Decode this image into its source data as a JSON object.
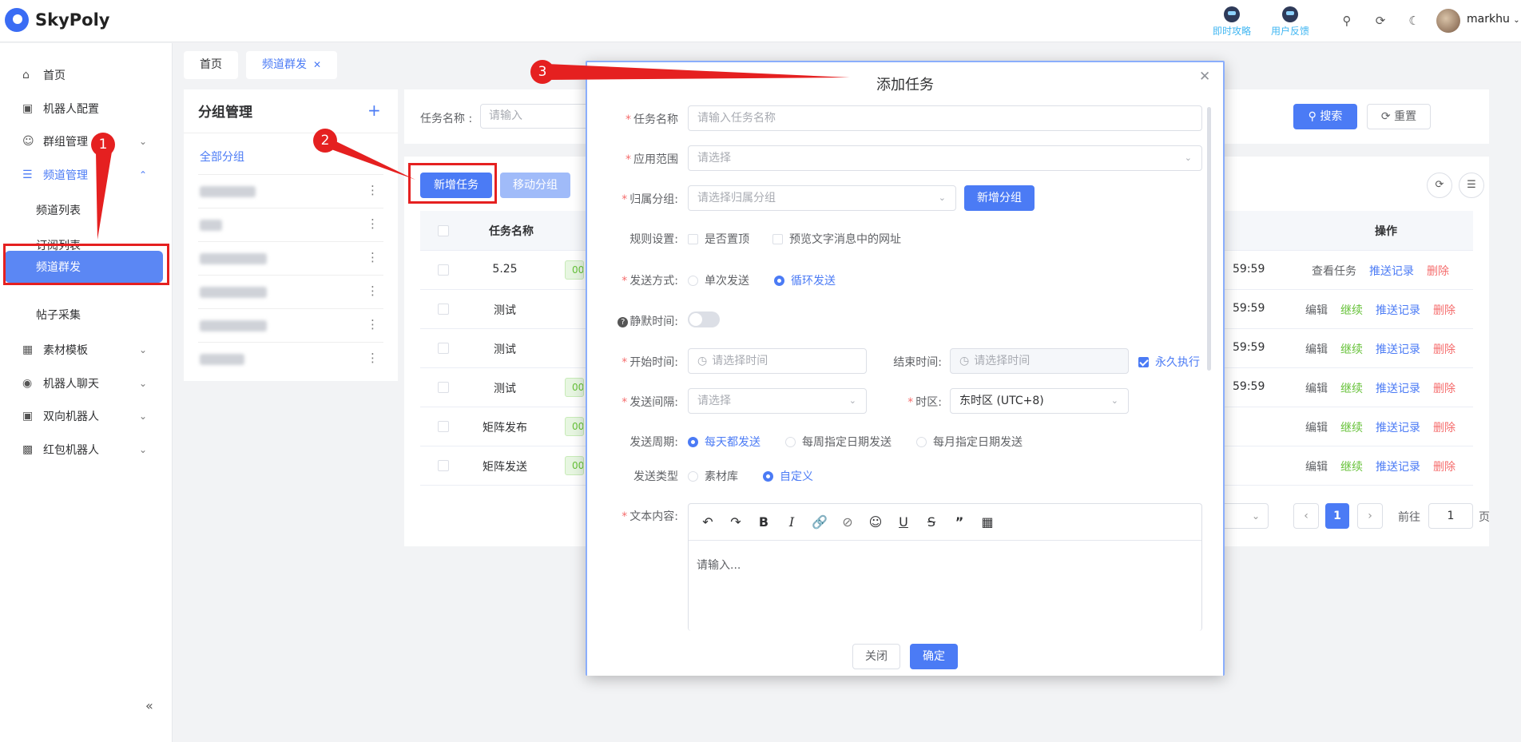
{
  "app": {
    "title": "SkyPoly"
  },
  "header": {
    "quick_start": "即时攻略",
    "feedback": "用户反馈",
    "username": "markhu"
  },
  "sidebar": {
    "items": [
      {
        "label": "首页"
      },
      {
        "label": "机器人配置"
      },
      {
        "label": "群组管理"
      },
      {
        "label": "频道管理"
      },
      {
        "label": "频道列表"
      },
      {
        "label": "订阅列表"
      },
      {
        "label": "频道群发"
      },
      {
        "label": "帖子采集"
      },
      {
        "label": "素材模板"
      },
      {
        "label": "机器人聊天"
      },
      {
        "label": "双向机器人"
      },
      {
        "label": "红包机器人"
      }
    ]
  },
  "tabs": [
    {
      "label": "首页"
    },
    {
      "label": "频道群发"
    }
  ],
  "group_panel": {
    "title": "分组管理",
    "all": "全部分组"
  },
  "search": {
    "label": "任务名称 :",
    "placeholder": "请输入",
    "search_btn": "搜索",
    "reset_btn": "重置"
  },
  "toolbar": {
    "new_task": "新增任务",
    "move_group": "移动分组"
  },
  "table": {
    "headers": {
      "name": "任务名称",
      "ops": "操作"
    },
    "rows": [
      {
        "name": "5.25",
        "tag": "00",
        "time": "59:59",
        "ops": [
          "查看任务",
          "推送记录",
          "删除"
        ]
      },
      {
        "name": "测试",
        "tag": "",
        "time": "59:59",
        "ops": [
          "编辑",
          "继续",
          "推送记录",
          "删除"
        ]
      },
      {
        "name": "测试",
        "tag": "",
        "time": "59:59",
        "ops": [
          "编辑",
          "继续",
          "推送记录",
          "删除"
        ]
      },
      {
        "name": "测试",
        "tag": "00",
        "time": "59:59",
        "ops": [
          "编辑",
          "继续",
          "推送记录",
          "删除"
        ]
      },
      {
        "name": "矩阵发布",
        "tag": "00",
        "time": "",
        "ops": [
          "编辑",
          "继续",
          "推送记录",
          "删除"
        ]
      },
      {
        "name": "矩阵发送",
        "tag": "00",
        "time": "",
        "ops": [
          "编辑",
          "继续",
          "推送记录",
          "删除"
        ]
      }
    ]
  },
  "pagination": {
    "current": "1",
    "goto_label": "前往",
    "goto_value": "1",
    "page_suffix": "页"
  },
  "dialog": {
    "title": "添加任务",
    "task_name_label": "任务名称",
    "task_name_placeholder": "请输入任务名称",
    "scope_label": "应用范围",
    "scope_placeholder": "请选择",
    "group_label": "归属分组:",
    "group_placeholder": "请选择归属分组",
    "new_group_btn": "新增分组",
    "rules_label": "规则设置:",
    "rule_pin": "是否置顶",
    "rule_preview": "预览文字消息中的网址",
    "send_mode_label": "发送方式:",
    "send_once": "单次发送",
    "send_loop": "循环发送",
    "silent_label": "静默时间:",
    "start_label": "开始时间:",
    "start_placeholder": "请选择时间",
    "end_label": "结束时间:",
    "end_placeholder": "请选择时间",
    "forever": "永久执行",
    "interval_label": "发送间隔:",
    "interval_placeholder": "请选择",
    "tz_label": "时区:",
    "tz_value": "东时区 (UTC+8)",
    "period_label": "发送周期:",
    "period_daily": "每天都发送",
    "period_weekly": "每周指定日期发送",
    "period_monthly": "每月指定日期发送",
    "type_label": "发送类型",
    "type_library": "素材库",
    "type_custom": "自定义",
    "content_label": "文本内容:",
    "editor_placeholder": "请输入...",
    "close_btn": "关闭",
    "confirm_btn": "确定"
  },
  "annotations": {
    "a1": "1",
    "a2": "2",
    "a3": "3"
  },
  "colors": {
    "primary": "#4b7bf5",
    "danger": "#f56c6c",
    "success": "#67c23a",
    "annotation": "#e52020"
  }
}
